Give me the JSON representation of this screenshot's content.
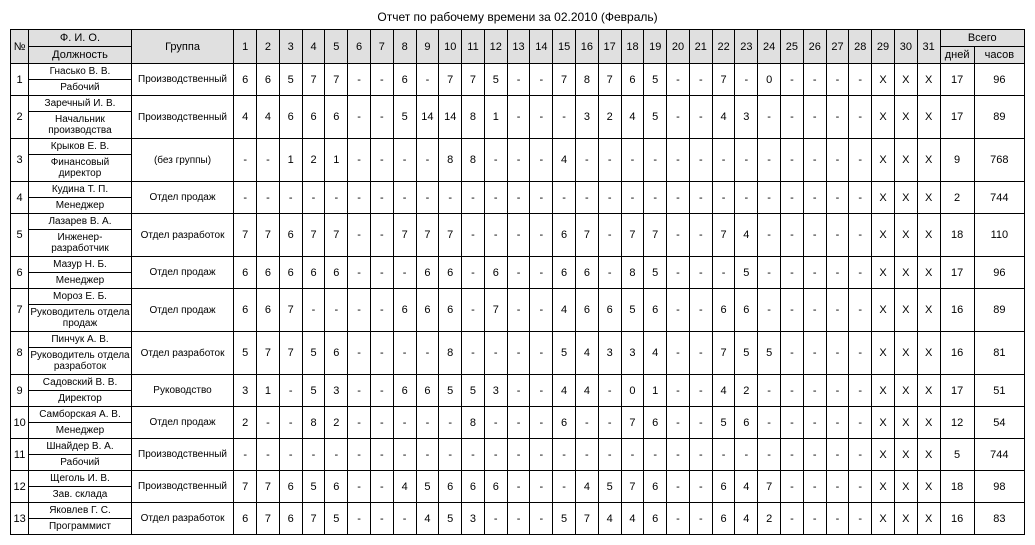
{
  "title": "Отчет по рабочему времени за 02.2010 (Февраль)",
  "headers": {
    "num": "№",
    "fio": "Ф. И. О.",
    "dolzhnost": "Должность",
    "group": "Группа",
    "total": "Всего",
    "days": "дней",
    "hours": "часов"
  },
  "day_labels": [
    "1",
    "2",
    "3",
    "4",
    "5",
    "6",
    "7",
    "8",
    "9",
    "10",
    "11",
    "12",
    "13",
    "14",
    "15",
    "16",
    "17",
    "18",
    "19",
    "20",
    "21",
    "22",
    "23",
    "24",
    "25",
    "26",
    "27",
    "28",
    "29",
    "30",
    "31"
  ],
  "rows": [
    {
      "n": "1",
      "fio": "Гнасько В. В.",
      "dol": "Рабочий",
      "grp": "Производственный",
      "d": [
        "6",
        "6",
        "5",
        "7",
        "7",
        "-",
        "-",
        "6",
        "-",
        "7",
        "7",
        "5",
        "-",
        "-",
        "7",
        "8",
        "7",
        "6",
        "5",
        "-",
        "-",
        "7",
        "-",
        "0",
        "-",
        "-",
        "-",
        "-",
        "X",
        "X",
        "X"
      ],
      "days": "17",
      "hours": "96"
    },
    {
      "n": "2",
      "fio": "Заречный И. В.",
      "dol": "Начальник производства",
      "grp": "Производственный",
      "d": [
        "4",
        "4",
        "6",
        "6",
        "6",
        "-",
        "-",
        "5",
        "14",
        "14",
        "8",
        "1",
        "-",
        "-",
        "-",
        "3",
        "2",
        "4",
        "5",
        "-",
        "-",
        "4",
        "3",
        "-",
        "-",
        "-",
        "-",
        "-",
        "X",
        "X",
        "X"
      ],
      "days": "17",
      "hours": "89"
    },
    {
      "n": "3",
      "fio": "Крыков Е. В.",
      "dol": "Финансовый директор",
      "grp": "(без группы)",
      "d": [
        "-",
        "-",
        "1",
        "2",
        "1",
        "-",
        "-",
        "-",
        "-",
        "8",
        "8",
        "-",
        "-",
        "-",
        "4",
        "-",
        "-",
        "-",
        "-",
        "-",
        "-",
        "-",
        "-",
        "-",
        "-",
        "-",
        "-",
        "-",
        "X",
        "X",
        "X"
      ],
      "days": "9",
      "hours": "768"
    },
    {
      "n": "4",
      "fio": "Кудина Т. П.",
      "dol": "Менеджер",
      "grp": "Отдел продаж",
      "d": [
        "-",
        "-",
        "-",
        "-",
        "-",
        "-",
        "-",
        "-",
        "-",
        "-",
        "-",
        "-",
        "-",
        "-",
        "-",
        "-",
        "-",
        "-",
        "-",
        "-",
        "-",
        "-",
        "-",
        "-",
        "-",
        "-",
        "-",
        "-",
        "X",
        "X",
        "X"
      ],
      "days": "2",
      "hours": "744"
    },
    {
      "n": "5",
      "fio": "Лазарев В. А.",
      "dol": "Инженер-разработчик",
      "grp": "Отдел разработок",
      "d": [
        "7",
        "7",
        "6",
        "7",
        "7",
        "-",
        "-",
        "7",
        "7",
        "7",
        "-",
        "-",
        "-",
        "-",
        "6",
        "7",
        "-",
        "7",
        "7",
        "-",
        "-",
        "7",
        "4",
        "-",
        "-",
        "-",
        "-",
        "-",
        "X",
        "X",
        "X"
      ],
      "days": "18",
      "hours": "110"
    },
    {
      "n": "6",
      "fio": "Мазур Н. Б.",
      "dol": "Менеджер",
      "grp": "Отдел продаж",
      "d": [
        "6",
        "6",
        "6",
        "6",
        "6",
        "-",
        "-",
        "-",
        "6",
        "6",
        "-",
        "6",
        "-",
        "-",
        "6",
        "6",
        "-",
        "8",
        "5",
        "-",
        "-",
        "-",
        "5",
        "-",
        "-",
        "-",
        "-",
        "-",
        "X",
        "X",
        "X"
      ],
      "days": "17",
      "hours": "96"
    },
    {
      "n": "7",
      "fio": "Мороз Е. Б.",
      "dol": "Руководитель отдела продаж",
      "grp": "Отдел продаж",
      "d": [
        "6",
        "6",
        "7",
        "-",
        "-",
        "-",
        "-",
        "6",
        "6",
        "6",
        "-",
        "7",
        "-",
        "-",
        "4",
        "6",
        "6",
        "5",
        "6",
        "-",
        "-",
        "6",
        "6",
        "-",
        "-",
        "-",
        "-",
        "-",
        "X",
        "X",
        "X"
      ],
      "days": "16",
      "hours": "89"
    },
    {
      "n": "8",
      "fio": "Пинчук А. В.",
      "dol": "Руководитель отдела разработок",
      "grp": "Отдел разработок",
      "d": [
        "5",
        "7",
        "7",
        "5",
        "6",
        "-",
        "-",
        "-",
        "-",
        "8",
        "-",
        "-",
        "-",
        "-",
        "5",
        "4",
        "3",
        "3",
        "4",
        "-",
        "-",
        "7",
        "5",
        "5",
        "-",
        "-",
        "-",
        "-",
        "X",
        "X",
        "X"
      ],
      "days": "16",
      "hours": "81"
    },
    {
      "n": "9",
      "fio": "Садовский В. В.",
      "dol": "Директор",
      "grp": "Руководство",
      "d": [
        "3",
        "1",
        "-",
        "5",
        "3",
        "-",
        "-",
        "6",
        "6",
        "5",
        "5",
        "3",
        "-",
        "-",
        "4",
        "4",
        "-",
        "0",
        "1",
        "-",
        "-",
        "4",
        "2",
        "-",
        "-",
        "-",
        "-",
        "-",
        "X",
        "X",
        "X"
      ],
      "days": "17",
      "hours": "51"
    },
    {
      "n": "10",
      "fio": "Самборская А. В.",
      "dol": "Менеджер",
      "grp": "Отдел продаж",
      "d": [
        "2",
        "-",
        "-",
        "8",
        "2",
        "-",
        "-",
        "-",
        "-",
        "-",
        "8",
        "-",
        "-",
        "-",
        "6",
        "-",
        "-",
        "7",
        "6",
        "-",
        "-",
        "5",
        "6",
        "-",
        "-",
        "-",
        "-",
        "-",
        "X",
        "X",
        "X"
      ],
      "days": "12",
      "hours": "54"
    },
    {
      "n": "11",
      "fio": "Шнайдер В. А.",
      "dol": "Рабочий",
      "grp": "Производственный",
      "d": [
        "-",
        "-",
        "-",
        "-",
        "-",
        "-",
        "-",
        "-",
        "-",
        "-",
        "-",
        "-",
        "-",
        "-",
        "-",
        "-",
        "-",
        "-",
        "-",
        "-",
        "-",
        "-",
        "-",
        "-",
        "-",
        "-",
        "-",
        "-",
        "X",
        "X",
        "X"
      ],
      "days": "5",
      "hours": "744"
    },
    {
      "n": "12",
      "fio": "Щеголь И. В.",
      "dol": "Зав. склада",
      "grp": "Производственный",
      "d": [
        "7",
        "7",
        "6",
        "5",
        "6",
        "-",
        "-",
        "4",
        "5",
        "6",
        "6",
        "6",
        "-",
        "-",
        "-",
        "4",
        "5",
        "7",
        "6",
        "-",
        "-",
        "6",
        "4",
        "7",
        "-",
        "-",
        "-",
        "-",
        "X",
        "X",
        "X"
      ],
      "days": "18",
      "hours": "98"
    },
    {
      "n": "13",
      "fio": "Яковлев Г. С.",
      "dol": "Программист",
      "grp": "Отдел разработок",
      "d": [
        "6",
        "7",
        "6",
        "7",
        "5",
        "-",
        "-",
        "-",
        "4",
        "5",
        "3",
        "-",
        "-",
        "-",
        "5",
        "7",
        "4",
        "4",
        "6",
        "-",
        "-",
        "6",
        "4",
        "2",
        "-",
        "-",
        "-",
        "-",
        "X",
        "X",
        "X"
      ],
      "days": "16",
      "hours": "83"
    }
  ]
}
